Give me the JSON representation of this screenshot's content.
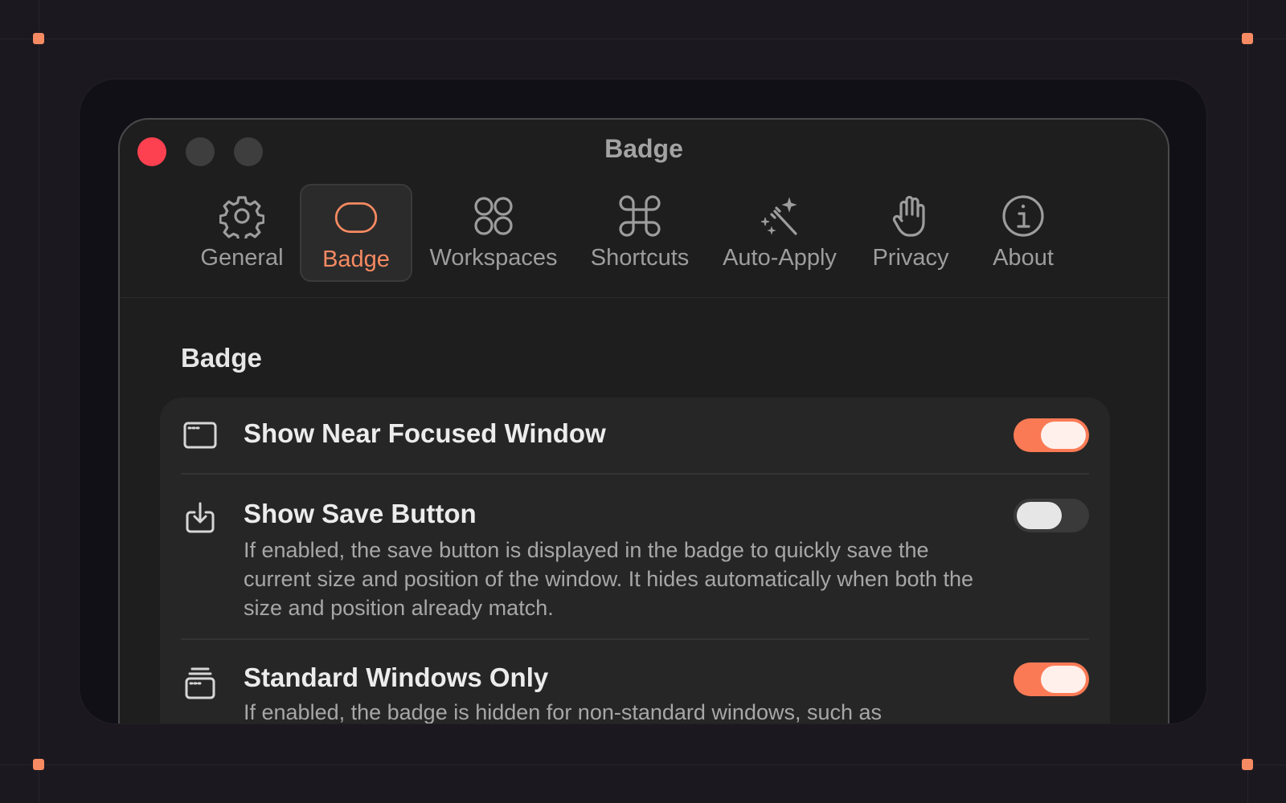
{
  "window": {
    "title": "Badge"
  },
  "tabs": [
    {
      "label": "General",
      "icon": "gear-icon"
    },
    {
      "label": "Badge",
      "icon": "badge-pill-icon",
      "active": true
    },
    {
      "label": "Workspaces",
      "icon": "four-circles-icon"
    },
    {
      "label": "Shortcuts",
      "icon": "command-icon"
    },
    {
      "label": "Auto-Apply",
      "icon": "magic-wand-icon"
    },
    {
      "label": "Privacy",
      "icon": "hand-icon"
    },
    {
      "label": "About",
      "icon": "info-icon"
    }
  ],
  "section": {
    "title": "Badge"
  },
  "settings": [
    {
      "title": "Show Near Focused Window",
      "description": "",
      "enabled": true,
      "icon": "window-icon"
    },
    {
      "title": "Show Save Button",
      "description": "If enabled, the save button is displayed in the badge to quickly save the current size and position of the window. It hides automatically when both the size and position already match.",
      "enabled": false,
      "icon": "save-download-icon"
    },
    {
      "title": "Standard Windows Only",
      "description": "If enabled, the badge is hidden for non-standard windows, such as",
      "enabled": true,
      "icon": "stacked-windows-icon"
    }
  ],
  "colors": {
    "accent": "#f68a62",
    "toggle_on": "#fa7a55",
    "close": "#fd4150",
    "background": "#1b1820"
  }
}
